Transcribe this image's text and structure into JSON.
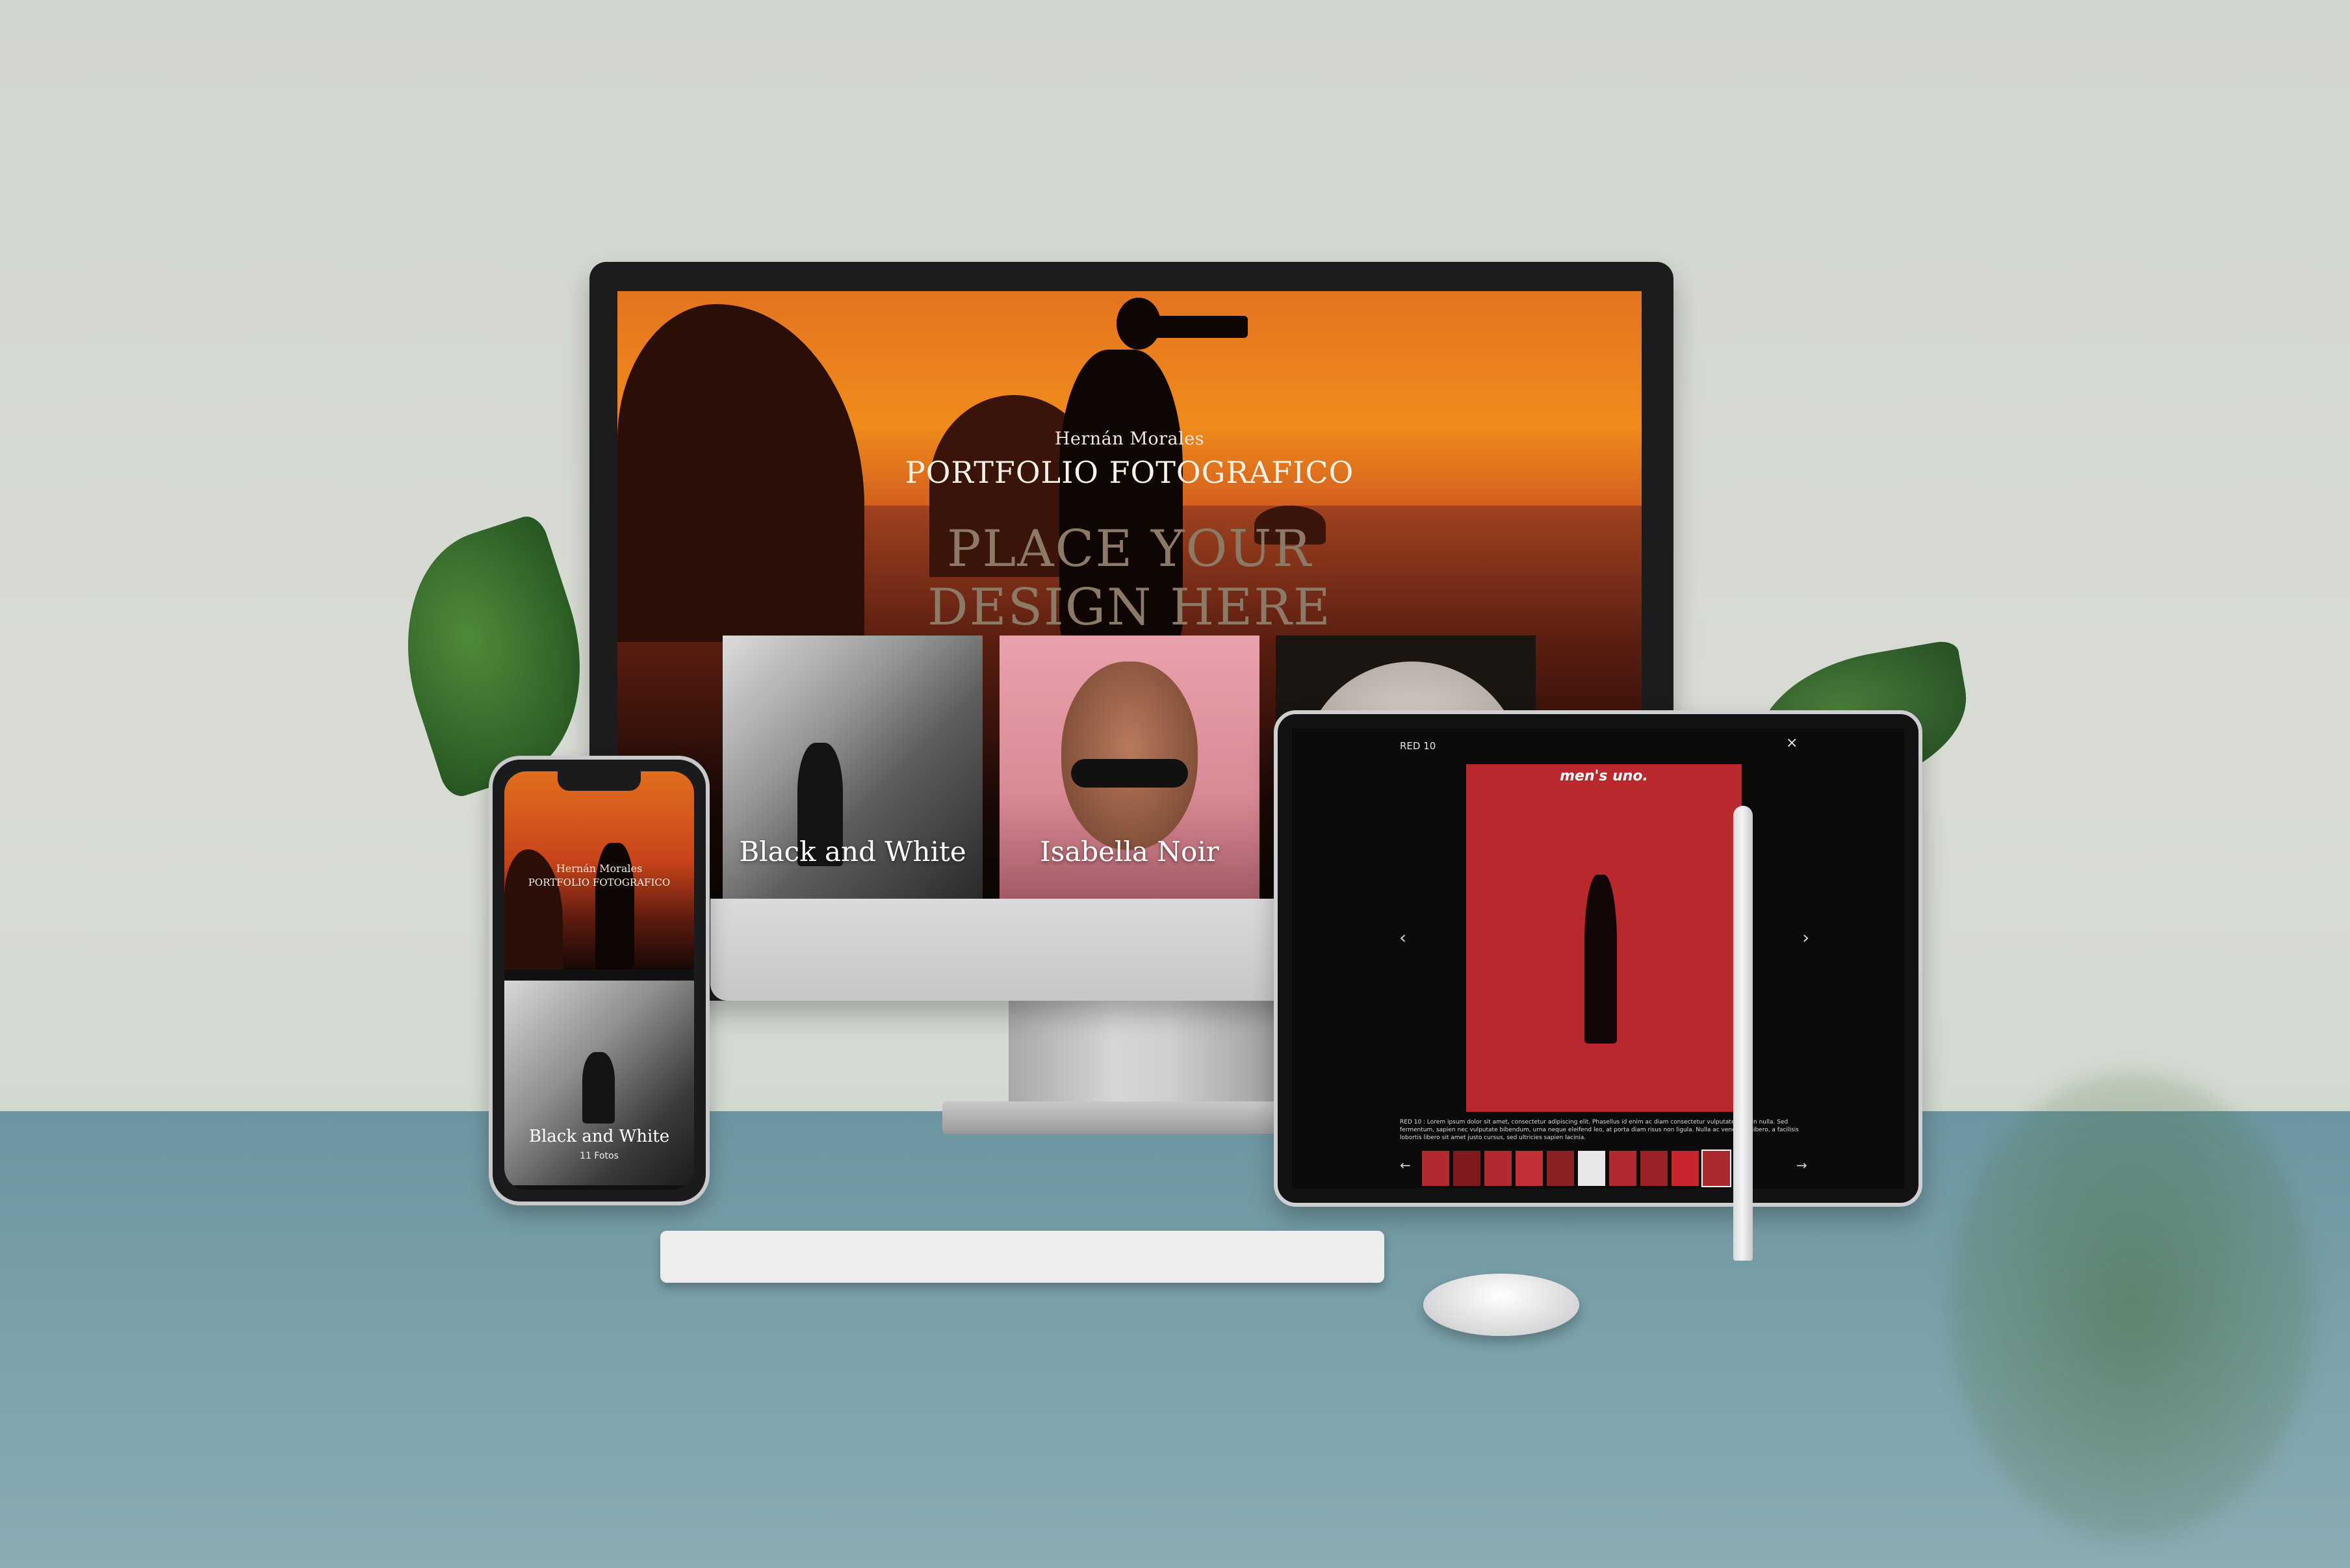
{
  "desktop": {
    "hero_name": "Hernán Morales",
    "hero_title": "PORTFOLIO FOTOGRAFICO",
    "placeholder_line1": "PLACE YOUR",
    "placeholder_line2": "DESIGN HERE",
    "cards": [
      {
        "label": "Black and White"
      },
      {
        "label": "Isabella Noir"
      }
    ]
  },
  "phone": {
    "hero_name": "Hernán Morales",
    "hero_title": "PORTFOLIO FOTOGRAFICO",
    "card_label": "Black and White",
    "card_count": "11 Fotos"
  },
  "tablet": {
    "title": "RED 10",
    "close": "×",
    "magazine_logo": "men's uno.",
    "prev_arrow": "‹",
    "next_arrow": "›",
    "thumb_prev": "←",
    "thumb_next": "→",
    "caption": "RED 10 : Lorem ipsum dolor sit amet, consectetur adipiscing elit. Phasellus id enim ac diam consectetur vulputate eget in nulla. Sed fermentum, sapien nec vulputate bibendum, urna neque eleifend leo, at porta diam risus non ligula. Nulla ac venenatis libero, a facilisis lobortis libero sit amet justo cursus, sed ultricies sapien lacinia."
  },
  "colors": {
    "sunset": "#e37420",
    "wall": "#d6dcd3",
    "desk": "#7aa0a9",
    "red_backdrop": "#b8282d"
  }
}
